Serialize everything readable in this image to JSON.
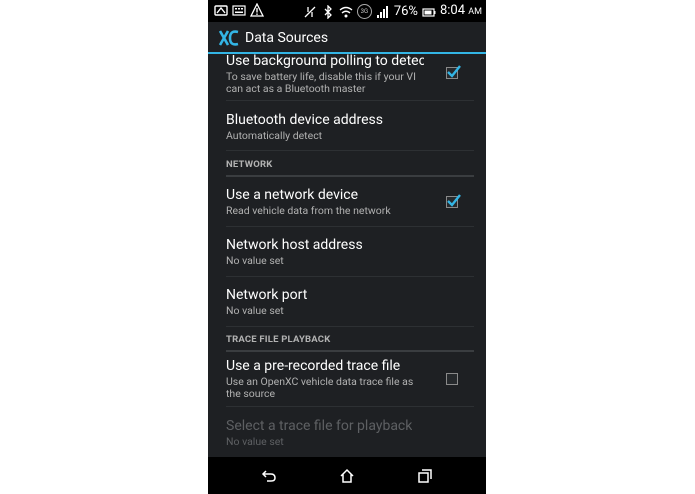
{
  "status_bar": {
    "battery_percent": "76%",
    "time": "8:04",
    "ampm": "AM",
    "network_badge": "3G",
    "icons_left": [
      "cast-icon",
      "keyboard-icon",
      "warning-icon"
    ],
    "icons_right": [
      "data-sync-icon",
      "bluetooth-icon",
      "wifi-icon",
      "network-badge",
      "signal-icon",
      "battery-icon"
    ]
  },
  "action_bar": {
    "title": "Data Sources",
    "accent_color": "#33b5e5"
  },
  "prefs": {
    "bg_polling": {
      "title": "Use background polling to detect",
      "summary_line1": "To save battery life, disable this if your VI",
      "summary_line2": "can act as a Bluetooth master",
      "checked": true
    },
    "bt_address": {
      "title": "Bluetooth device address",
      "summary": "Automatically detect"
    },
    "network_category": "NETWORK",
    "network_device": {
      "title": "Use a network device",
      "summary": "Read vehicle data from the network",
      "checked": true
    },
    "network_host": {
      "title": "Network host address",
      "summary": "No value set"
    },
    "network_port": {
      "title": "Network port",
      "summary": "No value set"
    },
    "trace_category": "TRACE FILE PLAYBACK",
    "trace_file": {
      "title": "Use a pre-recorded trace file",
      "summary_line1": "Use an OpenXC vehicle data trace file as",
      "summary_line2": "the source",
      "checked": false
    },
    "trace_select": {
      "title": "Select a trace file for playback",
      "summary": "No value set",
      "enabled": false
    }
  },
  "nav_bar": {
    "buttons": [
      "back-icon",
      "home-icon",
      "recents-icon"
    ]
  }
}
